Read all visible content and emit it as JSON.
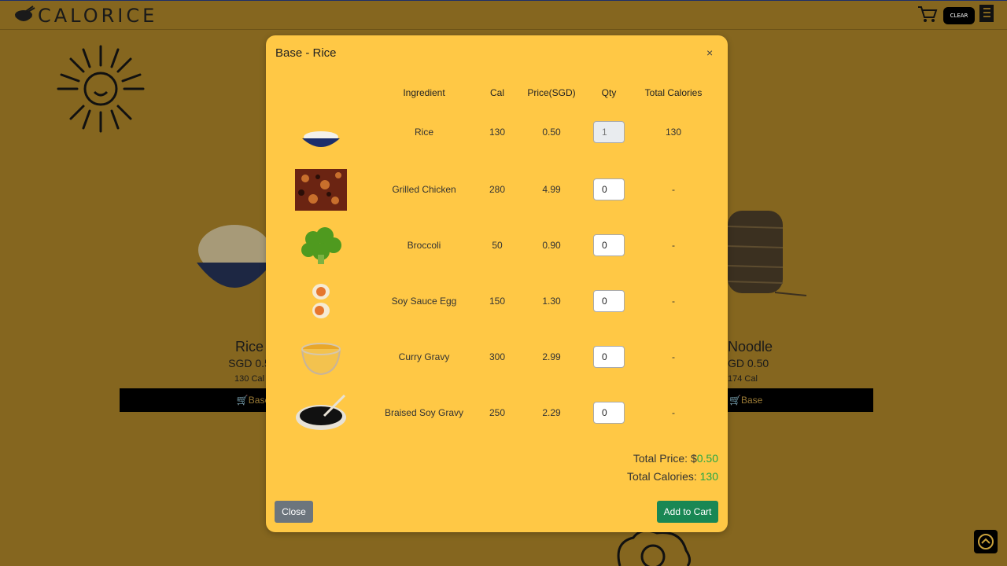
{
  "app": {
    "logo_text": "CALORICE",
    "clear_label": "CLEAR"
  },
  "background": {
    "products": [
      {
        "name": "Rice",
        "price": "SGD 0.5",
        "cal": "130 Cal",
        "button": "Base"
      },
      {
        "name": "Noodle",
        "price": "GD 0.50",
        "cal": "174 Cal",
        "button": "Base"
      }
    ]
  },
  "modal": {
    "title": "Base - Rice",
    "close_x": "×",
    "headers": [
      "Ingredient",
      "Cal",
      "Price(SGD)",
      "Qty",
      "Total Calories"
    ],
    "rows": [
      {
        "icon": "rice-bowl",
        "name": "Rice",
        "cal": "130",
        "price": "0.50",
        "qty": "1",
        "qty_disabled": true,
        "total": "130"
      },
      {
        "icon": "grilled-chicken",
        "name": "Grilled Chicken",
        "cal": "280",
        "price": "4.99",
        "qty": "0",
        "qty_disabled": false,
        "total": "-"
      },
      {
        "icon": "broccoli",
        "name": "Broccoli",
        "cal": "50",
        "price": "0.90",
        "qty": "0",
        "qty_disabled": false,
        "total": "-"
      },
      {
        "icon": "soy-sauce-egg",
        "name": "Soy Sauce Egg",
        "cal": "150",
        "price": "1.30",
        "qty": "0",
        "qty_disabled": false,
        "total": "-"
      },
      {
        "icon": "curry-gravy",
        "name": "Curry Gravy",
        "cal": "300",
        "price": "2.99",
        "qty": "0",
        "qty_disabled": false,
        "total": "-"
      },
      {
        "icon": "braised-soy-gravy",
        "name": "Braised Soy Gravy",
        "cal": "250",
        "price": "2.29",
        "qty": "0",
        "qty_disabled": false,
        "total": "-"
      }
    ],
    "total_price_label": "Total Price: $",
    "total_price_value": "0.50",
    "total_calories_label": "Total Calories: ",
    "total_calories_value": "130",
    "close_button": "Close",
    "add_button": "Add to Cart"
  },
  "colors": {
    "accent": "#ffc845",
    "overlay_bg": "#85661f",
    "green": "#28a745",
    "add_button": "#198754",
    "close_button": "#6c757d"
  }
}
